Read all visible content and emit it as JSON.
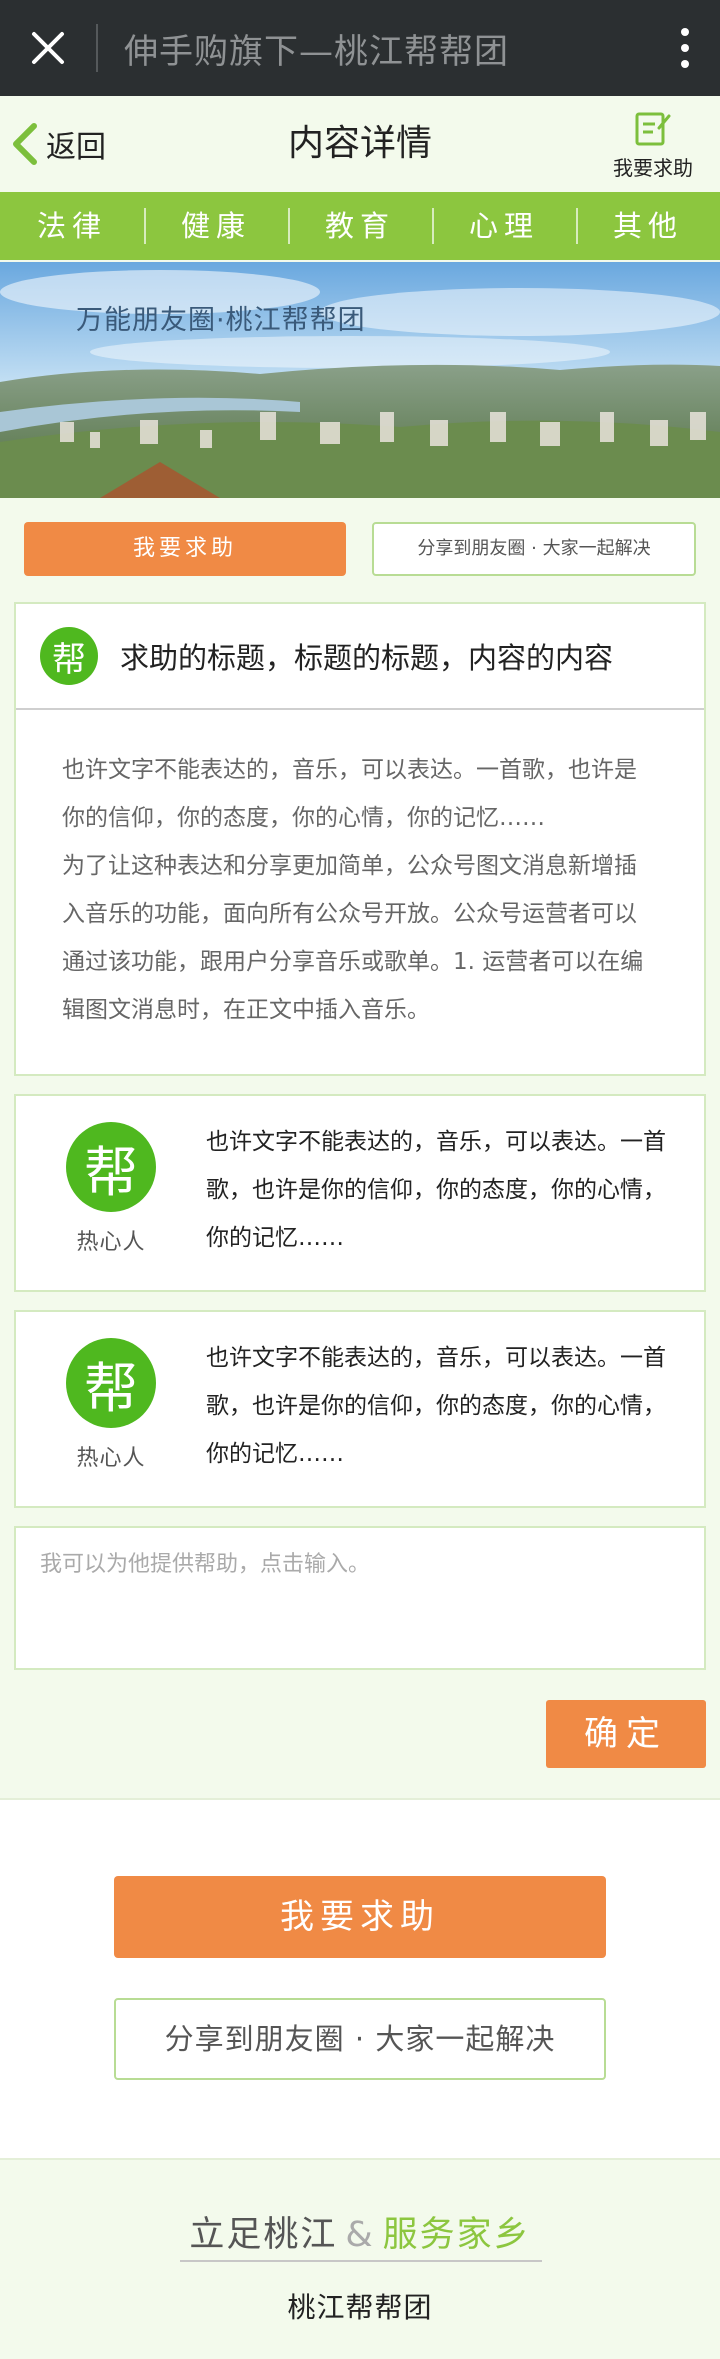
{
  "topbar": {
    "title": "伸手购旗下—桃江帮帮团",
    "close_icon": "close-icon",
    "more_icon": "more-vertical-icon"
  },
  "header": {
    "back_label": "返回",
    "title": "内容详情",
    "help_label": "我要求助"
  },
  "tabs": [
    "法律",
    "健康",
    "教育",
    "心理",
    "其他"
  ],
  "banner": {
    "text": "万能朋友圈·桃江帮帮团"
  },
  "actions": {
    "seek_help": "我要求助",
    "share": "分享到朋友圈 · 大家一起解决"
  },
  "question": {
    "badge": "帮",
    "title": "求助的标题，标题的标题，内容的内容",
    "paragraphs": [
      "也许文字不能表达的，音乐，可以表达。一首歌，也许是你的信仰，你的态度，你的心情，你的记忆……",
      "为了让这种表达和分享更加简单，公众号图文消息新增插入音乐的功能，面向所有公众号开放。公众号运营者可以通过该功能，跟用户分享音乐或歌单。1. 运营者可以在编辑图文消息时，在正文中插入音乐。"
    ]
  },
  "replies": [
    {
      "badge": "帮",
      "name": "热心人",
      "text": "也许文字不能表达的，音乐，可以表达。一首歌，也许是你的信仰，你的态度，你的心情，你的记忆……"
    },
    {
      "badge": "帮",
      "name": "热心人",
      "text": "也许文字不能表达的，音乐，可以表达。一首歌，也许是你的信仰，你的态度，你的心情，你的记忆……"
    }
  ],
  "input": {
    "placeholder": "我可以为他提供帮助，点击输入。",
    "value": ""
  },
  "confirm_label": "确定",
  "bottom_actions": {
    "seek_help": "我要求助",
    "share": "分享到朋友圈 · 大家一起解决"
  },
  "footer": {
    "slogan_left": "立足桃江",
    "slogan_amp": "&",
    "slogan_right": "服务家乡",
    "name": "桃江帮帮团"
  },
  "colors": {
    "green": "#8cc63f",
    "orange": "#f08a45",
    "badge_green": "#4fb81f",
    "topbar": "#2b2f31"
  }
}
